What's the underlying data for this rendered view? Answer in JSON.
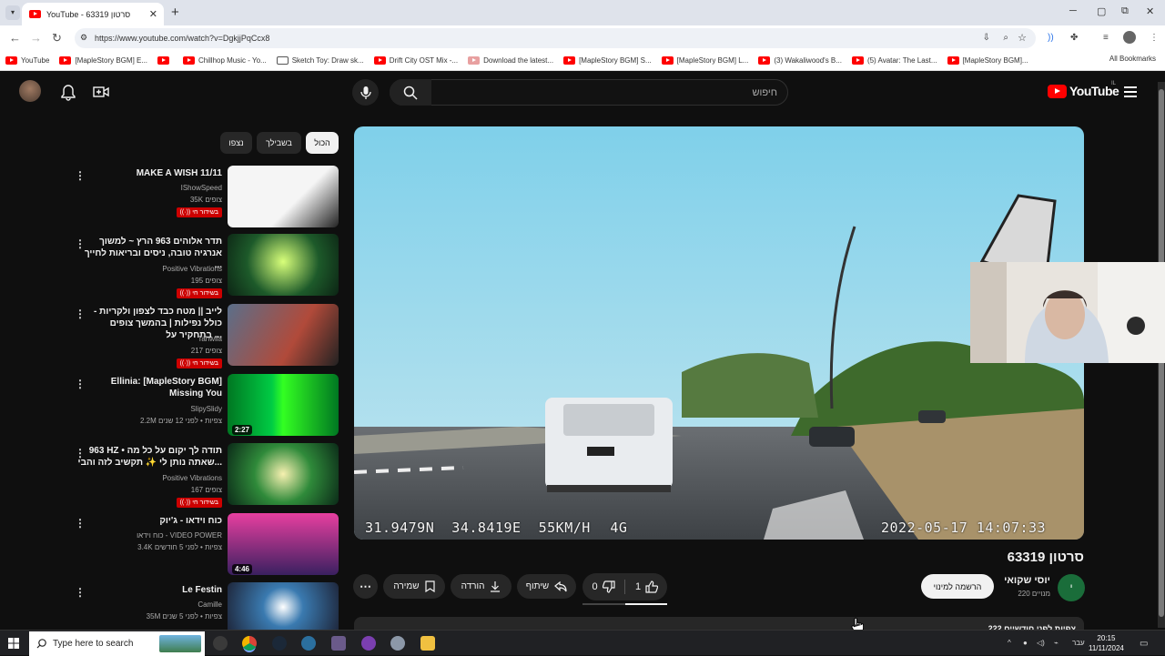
{
  "browser": {
    "tab_title": "YouTube - סרטון 63319",
    "url": "https://www.youtube.com/watch?v=DgkjjPqCcx8",
    "bookmarks": [
      "YouTube",
      "[MapleStory BGM] E...",
      "",
      "Chillhop Music - Yo...",
      "Sketch Toy: Draw sk...",
      "Drift City OST Mix -...",
      "Download the latest...",
      "[MapleStory BGM] S...",
      "[MapleStory BGM] L...",
      "(3) Wakaliwood's B...",
      "(5) Avatar: The Last...",
      "[MapleStory BGM]..."
    ],
    "all_bookmarks": "All Bookmarks"
  },
  "youtube": {
    "search_placeholder": "חיפוש",
    "logo_text": "YouTube",
    "country_code": "IL",
    "chips": [
      "הכול",
      "בשבילך",
      "נצפו"
    ],
    "recommendations": [
      {
        "title": "MAKE A WISH 11/11",
        "channel": "IShowSpeed",
        "meta": "35K צופים",
        "live": "בשידור חי"
      },
      {
        "title": "תדר אלוהים 963 הרץ ~ למשוך אנרגיה טובה, ניסים ובריאות לחייך ...",
        "channel": "Positive Vibrations",
        "meta": "195 צופים",
        "live": "בשידור חי"
      },
      {
        "title": "לייב || מטח כבד לצפון ולקריות - כולל נפילות | בהמשך צופים בתחקיר על ...",
        "channel": "Tahwila",
        "meta": "217 צופים",
        "live": "בשידור חי"
      },
      {
        "title": "Ellinia: [MapleStory BGM] Missing You",
        "channel": "SlipySlidy",
        "meta": "2.2M צפיות • לפני 12 שנים",
        "duration": "2:27"
      },
      {
        "title": "963 HZ • תודה לך יקום על כל מה שאתה נותן לי ✨ תקשיב לזה והבי...",
        "channel": "Positive Vibrations",
        "meta": "167 צופים",
        "live": "בשידור חי"
      },
      {
        "title": "כוח וידאו - ג'יוק",
        "channel": "כוח וידאו - VIDEO POWER",
        "meta": "3.4K צפיות • לפני 5 חודשים",
        "duration": "4:46"
      },
      {
        "title": "Le Festin",
        "channel": "Camille",
        "meta": "35M צפיות • לפני 5 שנים"
      }
    ],
    "video": {
      "overlay_coords": "31.9479N  34.8419E  55KM/H",
      "overlay_mid": "4G",
      "overlay_datetime": "2022-05-17 14:07:33",
      "title": "סרטון 63319",
      "channel_name": "יוסי שקואי",
      "channel_initial": "י",
      "subscribers": "220 מנויים",
      "subscribe_label": "הרשמה למינוי",
      "likes": "1",
      "dislikes": "0",
      "share_label": "שיתוף",
      "download_label": "הורדה",
      "save_label": "שמירה",
      "description_peek": "222 צפיות  לפני חודשיים"
    }
  },
  "taskbar": {
    "search_placeholder": "Type here to search",
    "lang": "עבר",
    "time": "20:15",
    "date": "11/11/2024"
  },
  "colors": {
    "accent_red": "#ff0000",
    "live_badge": "#cc0000",
    "background": "#0f0f0f"
  }
}
